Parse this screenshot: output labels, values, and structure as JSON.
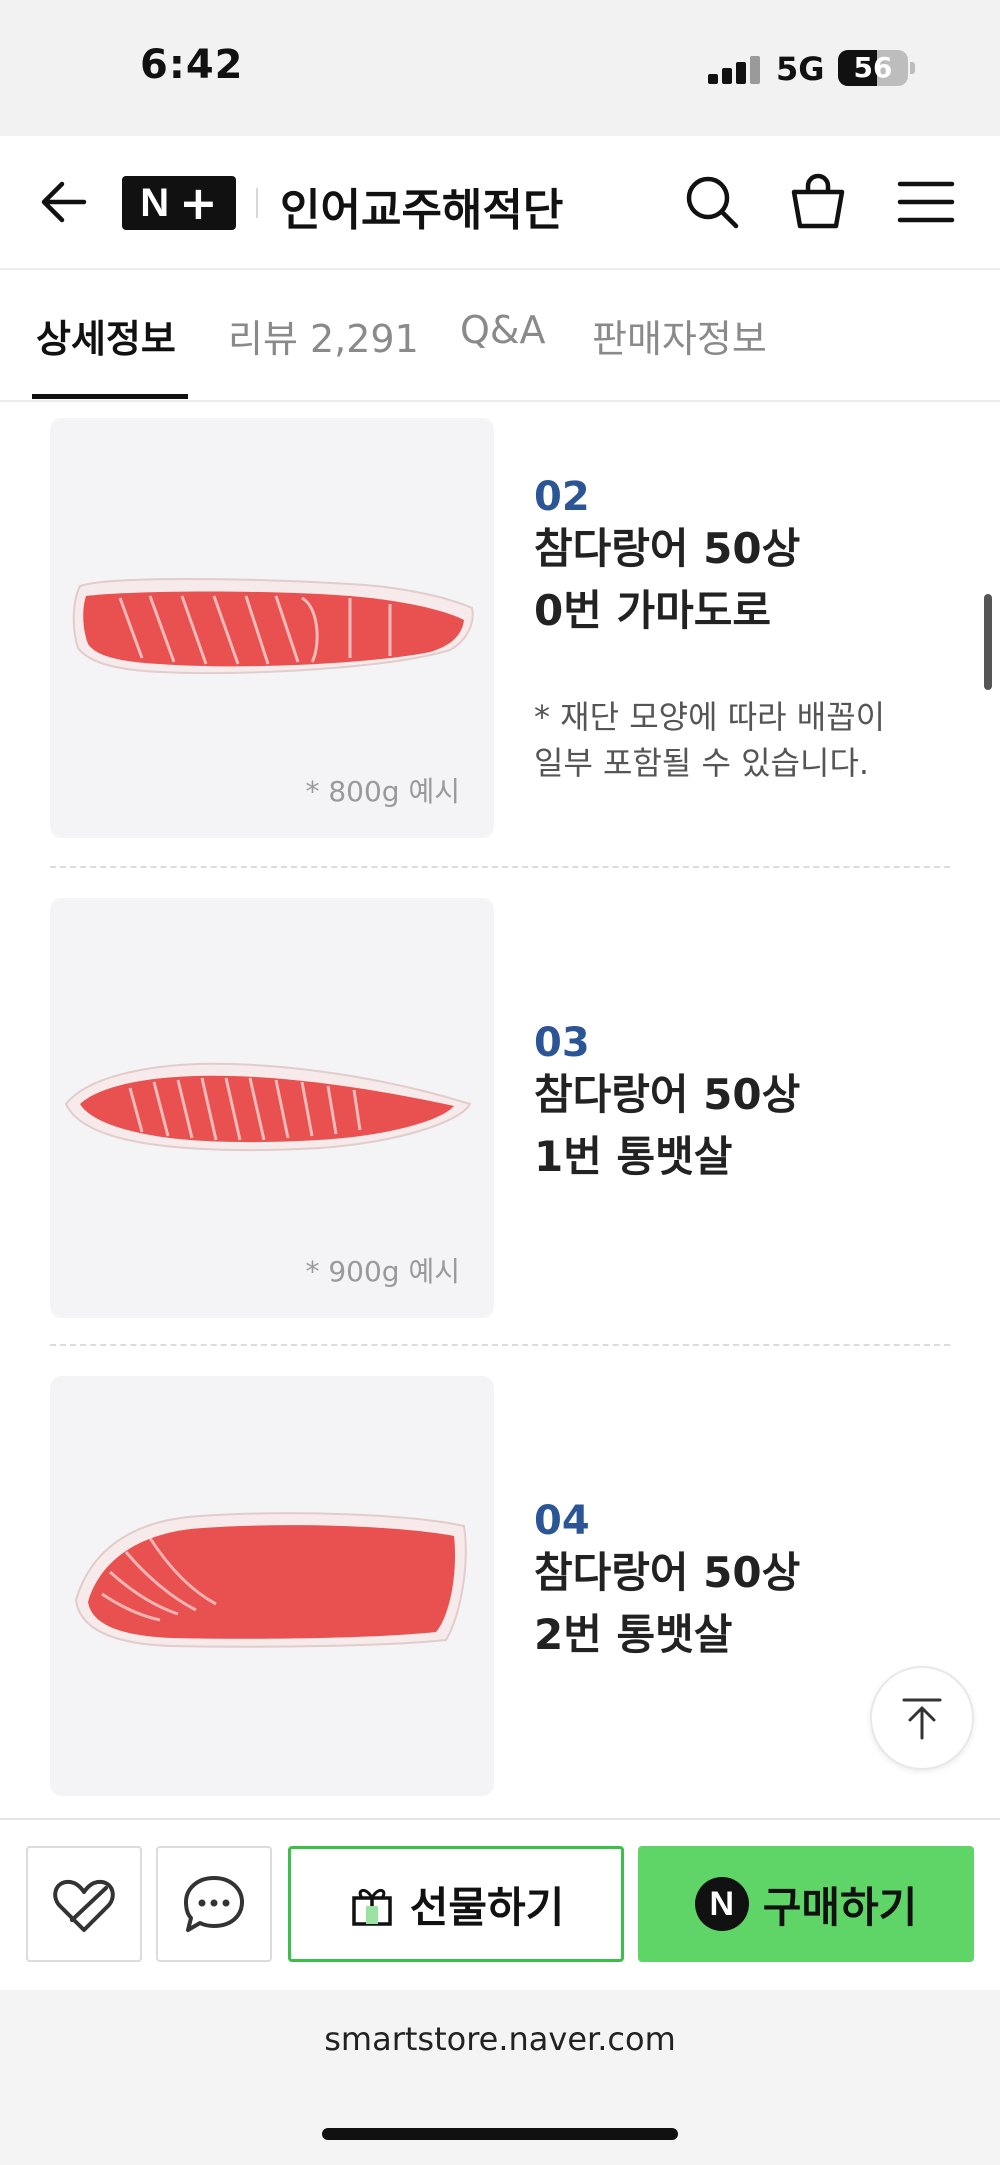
{
  "status_bar": {
    "time": "6:42",
    "network": "5G",
    "battery": "56",
    "battery_level": 0.56
  },
  "header": {
    "store_name": "인어교주해적단",
    "logo_letter": "N",
    "logo_plus": "+"
  },
  "tabs": [
    {
      "label": "상세정보",
      "active": true
    },
    {
      "label": "리뷰 2,291",
      "active": false
    },
    {
      "label": "Q&A",
      "active": false
    },
    {
      "label": "판매자정보",
      "active": false
    }
  ],
  "items": [
    {
      "number": "02",
      "name_line1": "참다랑어 50상",
      "name_line2": "0번 가마도로",
      "note_line1": "* 재단 모양에 따라 배꼽이",
      "note_line2": "일부 포함될 수 있습니다.",
      "caption": "* 800g 예시"
    },
    {
      "number": "03",
      "name_line1": "참다랑어 50상",
      "name_line2": "1번 통뱃살",
      "caption": "* 900g 예시"
    },
    {
      "number": "04",
      "name_line1": "참다랑어 50상",
      "name_line2": "2번 통뱃살"
    }
  ],
  "bottom_bar": {
    "gift_label": "선물하기",
    "buy_label": "구매하기",
    "buy_mark": "N"
  },
  "browser": {
    "url": "smartstore.naver.com"
  },
  "colors": {
    "accent_blue": "#2c5596",
    "buy_green": "#5fd568",
    "gift_border": "#3cbf4a",
    "tuna_red": "#e8514f"
  }
}
